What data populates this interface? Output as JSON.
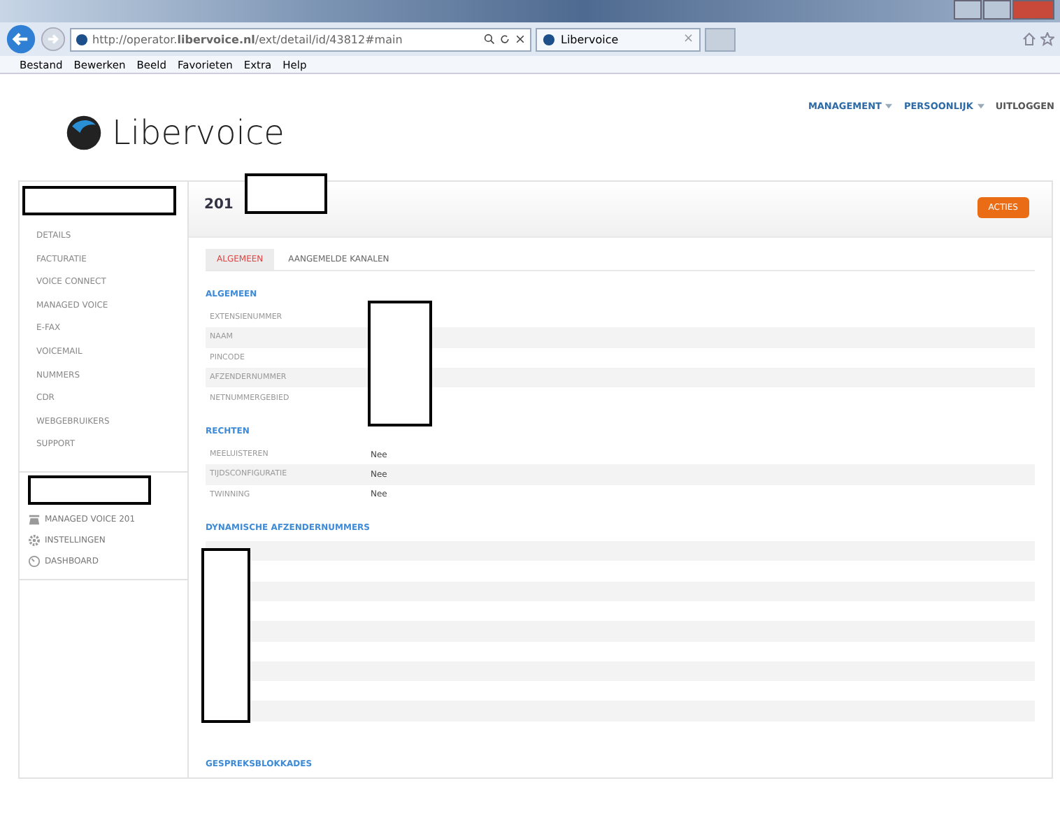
{
  "browser": {
    "url": "http://operator.**libervoice.nl**/ext/detail/id/43812#main",
    "tab": {
      "title": "Libervoice",
      "close": "×"
    },
    "menu": [
      "Bestand",
      "Bewerken",
      "Beeld",
      "Favorieten",
      "Extra",
      "Help"
    ]
  },
  "logo": {
    "text": "Libervoice"
  },
  "topnav": [
    {
      "label": "MANAGEMENT",
      "dropdown": true
    },
    {
      "label": "PERSOONLIJK",
      "dropdown": true
    },
    {
      "label": "UITLOGGEN",
      "dropdown": false
    }
  ],
  "sidebar": {
    "items": [
      "DETAILS",
      "FACTURATIE",
      "VOICE CONNECT",
      "MANAGED VOICE",
      "E-FAX",
      "VOICEMAIL",
      "NUMMERS",
      "CDR",
      "WEBGEBRUIKERS",
      "SUPPORT"
    ],
    "links": [
      {
        "kind": "phone",
        "label": "MANAGED VOICE 201"
      },
      {
        "kind": "gear",
        "label": "INSTELLINGEN"
      },
      {
        "kind": "dashboard",
        "label": "DASHBOARD"
      }
    ]
  },
  "page": {
    "title": "201",
    "action": "ACTIES",
    "tabs": [
      {
        "label": "ALGEMEEN",
        "selected": true
      },
      {
        "label": "AANGEMELDE KANALEN",
        "selected": false
      }
    ],
    "sections": [
      {
        "title": "ALGEMEEN",
        "kind": "fields",
        "rows": [
          {
            "label": "EXTENSIENUMMER"
          },
          {
            "label": "NAAM"
          },
          {
            "label": "PINCODE"
          },
          {
            "label": "AFZENDERNUMMER"
          },
          {
            "label": "NETNUMMERGEBIED"
          }
        ]
      },
      {
        "title": "RECHTEN",
        "kind": "fields",
        "rows": [
          {
            "label": "MEELUISTEREN",
            "value": "Nee"
          },
          {
            "label": "TIJDSCONFIGURATIE",
            "value": "Nee"
          },
          {
            "label": "TWINNING",
            "value": "Nee"
          }
        ]
      },
      {
        "title": "DYNAMISCHE AFZENDERNUMMERS",
        "kind": "list"
      },
      {
        "title": "GESPREKSBLOKKADES",
        "kind": "empty"
      }
    ]
  }
}
